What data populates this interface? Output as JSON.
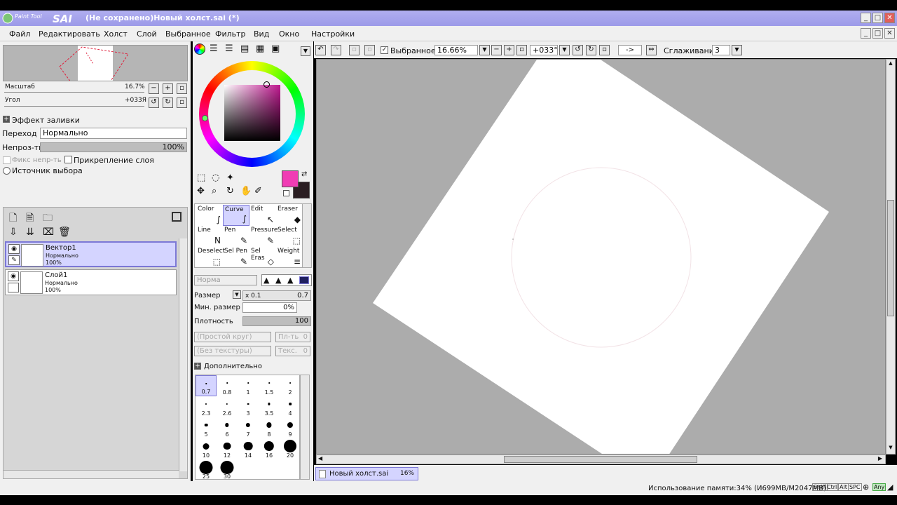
{
  "window": {
    "app_name": "SAI",
    "app_small": "Paint Tool",
    "title": "(Не сохранено)Новый холст.sai (*)",
    "min": "_",
    "max": "□",
    "close": "✕"
  },
  "menu": [
    "Файл",
    "Редактировать",
    "Холст",
    "Слой",
    "Выбранное",
    "Фильтр",
    "Вид",
    "Окно",
    "Настройки"
  ],
  "navigator": {
    "zoom_label": "Масштаб",
    "zoom_value": "16.7%",
    "angle_label": "Угол",
    "angle_value": "+033Я"
  },
  "fill_effect": {
    "header": "Эффект заливки",
    "blend_label": "Переход",
    "blend_value": "Нормально",
    "opacity_label": "Непроз-ть",
    "opacity_value": "100%",
    "opacity_fraction": 1.0,
    "preserve_opacity": "Фикс непр-ть",
    "clip_layer": "Прикрепление слоя",
    "selection_source": "Источник выбора"
  },
  "layers": [
    {
      "name": "Вектор1",
      "mode": "Нормально",
      "opacity": "100%",
      "selected": true
    },
    {
      "name": "Слой1",
      "mode": "Нормально",
      "opacity": "100%",
      "selected": false
    }
  ],
  "colors": {
    "primary": "#f03cb4",
    "secondary": "#2a1e22",
    "accent": "#7c78d6",
    "canvas_bg": "#acacac"
  },
  "tools": [
    {
      "label": "Color",
      "icon": "color-curve-icon"
    },
    {
      "label": "Curve",
      "icon": "curve-icon",
      "selected": true
    },
    {
      "label": "Edit",
      "icon": "edit-arrow-icon"
    },
    {
      "label": "Eraser",
      "icon": "eraser-icon"
    },
    {
      "label": "Line",
      "icon": "line-icon"
    },
    {
      "label": "Pen",
      "icon": "pen-icon"
    },
    {
      "label": "Pressure",
      "icon": "pressure-icon"
    },
    {
      "label": "Select",
      "icon": "select-icon"
    },
    {
      "label": "Deselect",
      "icon": "deselect-icon"
    },
    {
      "label": "Sel Pen",
      "icon": "sel-pen-icon"
    },
    {
      "label": "Sel Eras",
      "icon": "sel-eraser-icon"
    },
    {
      "label": "Weight",
      "icon": "weight-icon"
    }
  ],
  "brush": {
    "mode_placeholder": "Норма",
    "size_label": "Размер",
    "size_mult": "x 0.1",
    "size_value": "0.7",
    "min_size_label": "Мин. размер",
    "min_size_value": "0%",
    "density_label": "Плотность",
    "density_value": "100",
    "shape": "(Простой круг)",
    "shape_val_label": "Пл-ть",
    "shape_val": "0",
    "texture": "(Без текстуры)",
    "texture_val_label": "Текс.",
    "texture_val": "0",
    "advanced": "Дополнительно",
    "sizes": [
      "0.7",
      "0.8",
      "1",
      "1.5",
      "2",
      "2.3",
      "2.6",
      "3",
      "3.5",
      "4",
      "5",
      "6",
      "7",
      "8",
      "9",
      "10",
      "12",
      "14",
      "16",
      "20",
      "25",
      "30"
    ]
  },
  "toolbar": {
    "selection_label": "Выбранное",
    "zoom": "16.66%",
    "angle": "+033°",
    "arrow": "->",
    "smoothing_label": "Сглаживание",
    "smoothing_value": "3"
  },
  "tab": {
    "name": "Новый холст.sai",
    "zoom": "16%"
  },
  "status": {
    "memory": "Использование памяти:34% (И699MB/M2047MB)",
    "keys": [
      "Shift",
      "Ctrl",
      "Alt",
      "SPC",
      "Any"
    ]
  }
}
